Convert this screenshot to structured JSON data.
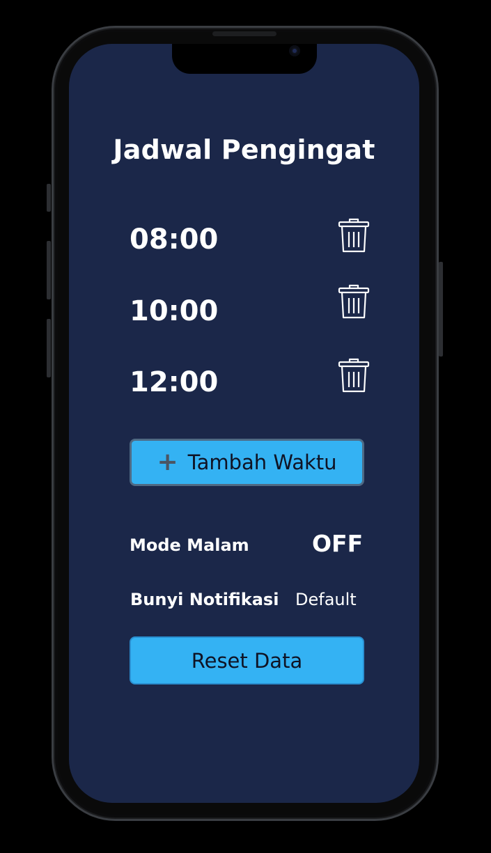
{
  "screen": {
    "title": "Jadwal Pengingat",
    "reminders": [
      {
        "time": "08:00",
        "delete_icon": "trash-icon"
      },
      {
        "time": "10:00",
        "delete_icon": "trash-icon"
      },
      {
        "time": "12:00",
        "delete_icon": "trash-icon"
      }
    ],
    "add_button": {
      "icon": "plus-icon",
      "label": "Tambah Waktu"
    },
    "settings": {
      "night_mode": {
        "label": "Mode Malam",
        "value": "OFF"
      },
      "notification_sound": {
        "label": "Bunyi Notifikasi",
        "value": "Default"
      }
    },
    "reset_button": {
      "label": "Reset Data"
    }
  },
  "colors": {
    "background": "#1b2749",
    "button": "#34b2f3",
    "text": "#ffffff",
    "button_text": "#0f1324"
  }
}
